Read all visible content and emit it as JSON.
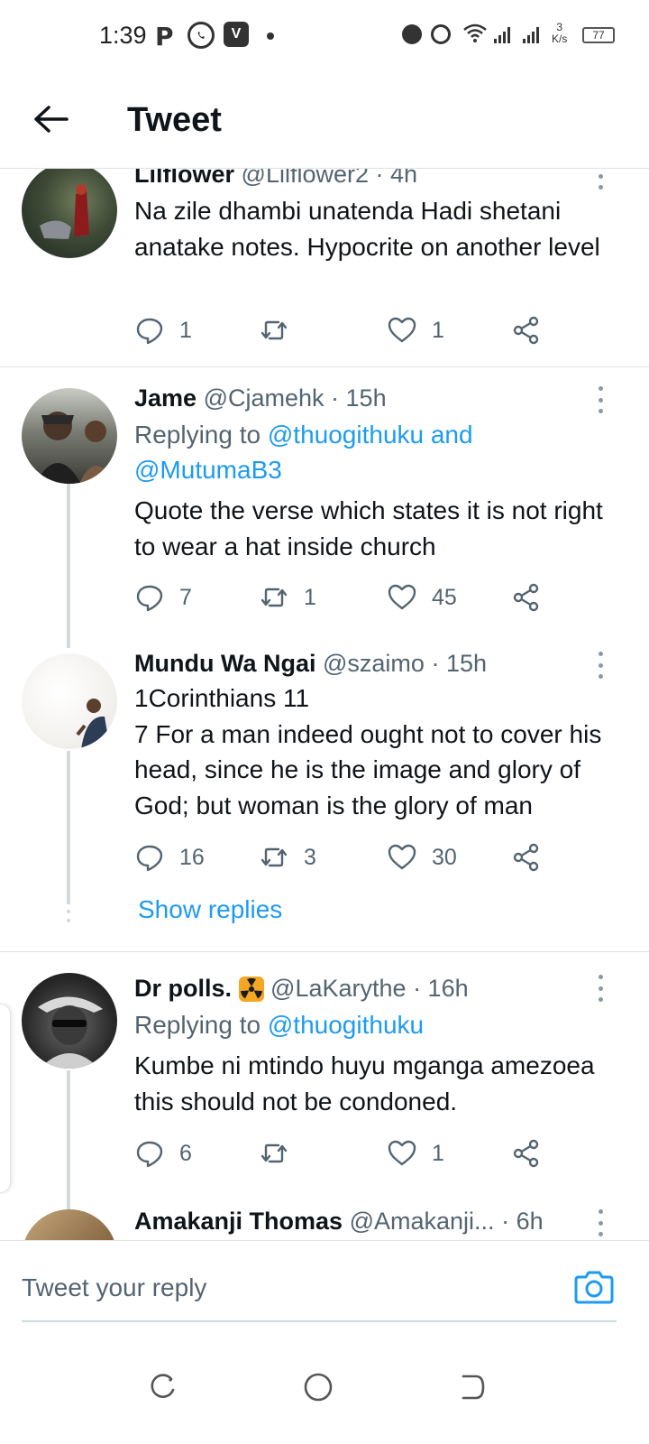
{
  "status_bar": {
    "time": "1:39",
    "app_p": "P",
    "app_v": "V",
    "speed_value": "3",
    "speed_unit": "K/s",
    "battery": "77"
  },
  "header": {
    "title": "Tweet"
  },
  "tweets": [
    {
      "name": "Lilflower",
      "handle": "@Lilflower2",
      "time": "· 4h",
      "text": "Na zile dhambi unatenda Hadi shetani anatake notes. Hypocrite on another level",
      "replies": "1",
      "retweets": "",
      "likes": "1"
    },
    {
      "name": "Jame",
      "handle": "@Cjamehk",
      "time": "· 15h",
      "replying_label": "Replying to",
      "replying_mentions": "@thuogithuku and @MutumaB3",
      "text": "Quote the verse which states it is not right to wear a hat inside church",
      "replies": "7",
      "retweets": "1",
      "likes": "45"
    },
    {
      "name": "Mundu Wa Ngai",
      "handle": "@szaimo",
      "time": "· 15h",
      "text": "1Corinthians 11\n7 For a man indeed ought not to cover his head, since he is the image and glory of God; but woman is the glory of man",
      "replies": "16",
      "retweets": "3",
      "likes": "30"
    },
    {
      "name": "Dr polls.",
      "handle": "@LaKarythe",
      "time": "· 16h",
      "replying_label": "Replying to",
      "replying_mentions": "@thuogithuku",
      "text": "Kumbe ni mtindo huyu mganga amezoea this should not be condoned.",
      "replies": "6",
      "retweets": "",
      "likes": "1"
    },
    {
      "name": "Amakanji Thomas",
      "handle": "@Amakanji...",
      "time": "· 6h"
    }
  ],
  "show_replies": "Show replies",
  "compose": {
    "placeholder": "Tweet your reply"
  },
  "icons": {
    "back": "back-arrow-icon",
    "more": "more-vertical-icon",
    "reply": "reply-bubble-icon",
    "retweet": "retweet-icon",
    "like": "heart-icon",
    "share": "share-icon",
    "camera": "camera-icon",
    "badge": "radioactive-emoji-icon"
  },
  "colors": {
    "accent": "#1d9bf0",
    "text_primary": "#0f1419",
    "text_secondary": "#536471",
    "badge": "#f5a623"
  }
}
